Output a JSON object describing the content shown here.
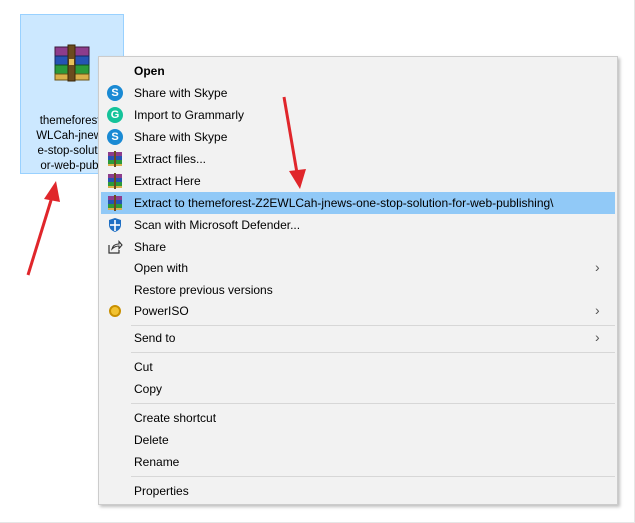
{
  "file": {
    "name": "themeforest-\nWLCah-jnews\ne-stop-solutio\nor-web-publi"
  },
  "menu": {
    "items": [
      {
        "label": "Open",
        "icon": "none",
        "bold": true
      },
      {
        "label": "Share with Skype",
        "icon": "skype-icon"
      },
      {
        "label": "Import to Grammarly",
        "icon": "grammarly-icon"
      },
      {
        "label": "Share with Skype",
        "icon": "skype-icon"
      },
      {
        "label": "Extract files...",
        "icon": "winrar-icon"
      },
      {
        "label": "Extract Here",
        "icon": "winrar-icon"
      },
      {
        "label": "Extract to themeforest-Z2EWLCah-jnews-one-stop-solution-for-web-publishing\\",
        "icon": "winrar-icon",
        "highlighted": true
      },
      {
        "label": "Scan with Microsoft Defender...",
        "icon": "defender-icon"
      },
      {
        "label": "Share",
        "icon": "share-icon"
      },
      {
        "label": "Open with",
        "icon": "none",
        "submenu": true
      },
      {
        "label": "Restore previous versions",
        "icon": "none"
      },
      {
        "label": "PowerISO",
        "icon": "poweriso-icon",
        "submenu": true
      },
      {
        "label": "Send to",
        "icon": "none",
        "submenu": true
      },
      {
        "label": "Cut",
        "icon": "none"
      },
      {
        "label": "Copy",
        "icon": "none"
      },
      {
        "label": "Create shortcut",
        "icon": "none"
      },
      {
        "label": "Delete",
        "icon": "none"
      },
      {
        "label": "Rename",
        "icon": "none"
      },
      {
        "label": "Properties",
        "icon": "none"
      }
    ],
    "submenu_glyph": "›"
  },
  "colors": {
    "highlight": "#91c9f7",
    "annotation_arrow": "#e0262b"
  }
}
